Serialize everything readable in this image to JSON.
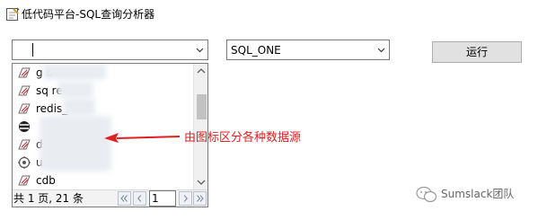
{
  "window": {
    "title": "低代码平台-SQL查询分析器",
    "icon": "window-app-icon"
  },
  "toolbar": {
    "source_combo_value": "",
    "db_combo_value": "SQL_ONE",
    "run_label": "运行"
  },
  "dropdown": {
    "items": [
      {
        "label": "g d",
        "icon": "sql-server-icon"
      },
      {
        "label": "sq re",
        "icon": "sql-server-icon"
      },
      {
        "label": "redis_",
        "icon": "sql-server-icon"
      },
      {
        "label": "",
        "icon": "db-cylinder-icon"
      },
      {
        "label": "d _",
        "icon": "sql-server-icon"
      },
      {
        "label": "u",
        "icon": "gear-db-icon"
      },
      {
        "label": "cdb",
        "icon": "sql-server-icon"
      }
    ],
    "pager": {
      "info": "共 1 页, 21 条",
      "page_value": "1"
    }
  },
  "annotation": {
    "text": "由图标区分各种数据源",
    "color": "#e02020"
  },
  "watermark": {
    "text": "Sumslack团队"
  }
}
